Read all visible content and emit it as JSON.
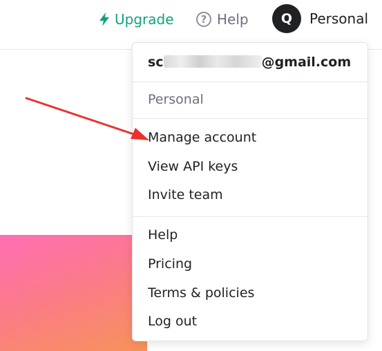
{
  "header": {
    "upgrade_label": "Upgrade",
    "help_label": "Help",
    "help_icon_glyph": "?",
    "avatar_initial": "Q",
    "account_label": "Personal"
  },
  "menu": {
    "email_prefix": "sc",
    "email_suffix": "@gmail.com",
    "org_label": "Personal",
    "section1": [
      "Manage account",
      "View API keys",
      "Invite team"
    ],
    "section2": [
      "Help",
      "Pricing",
      "Terms & policies",
      "Log out"
    ]
  },
  "colors": {
    "accent": "#10a37f",
    "annotation_arrow": "#e8322f",
    "avatar_bg": "#202123"
  },
  "icons": {
    "upgrade": "lightning-bolt-icon",
    "help": "question-circle-icon"
  }
}
